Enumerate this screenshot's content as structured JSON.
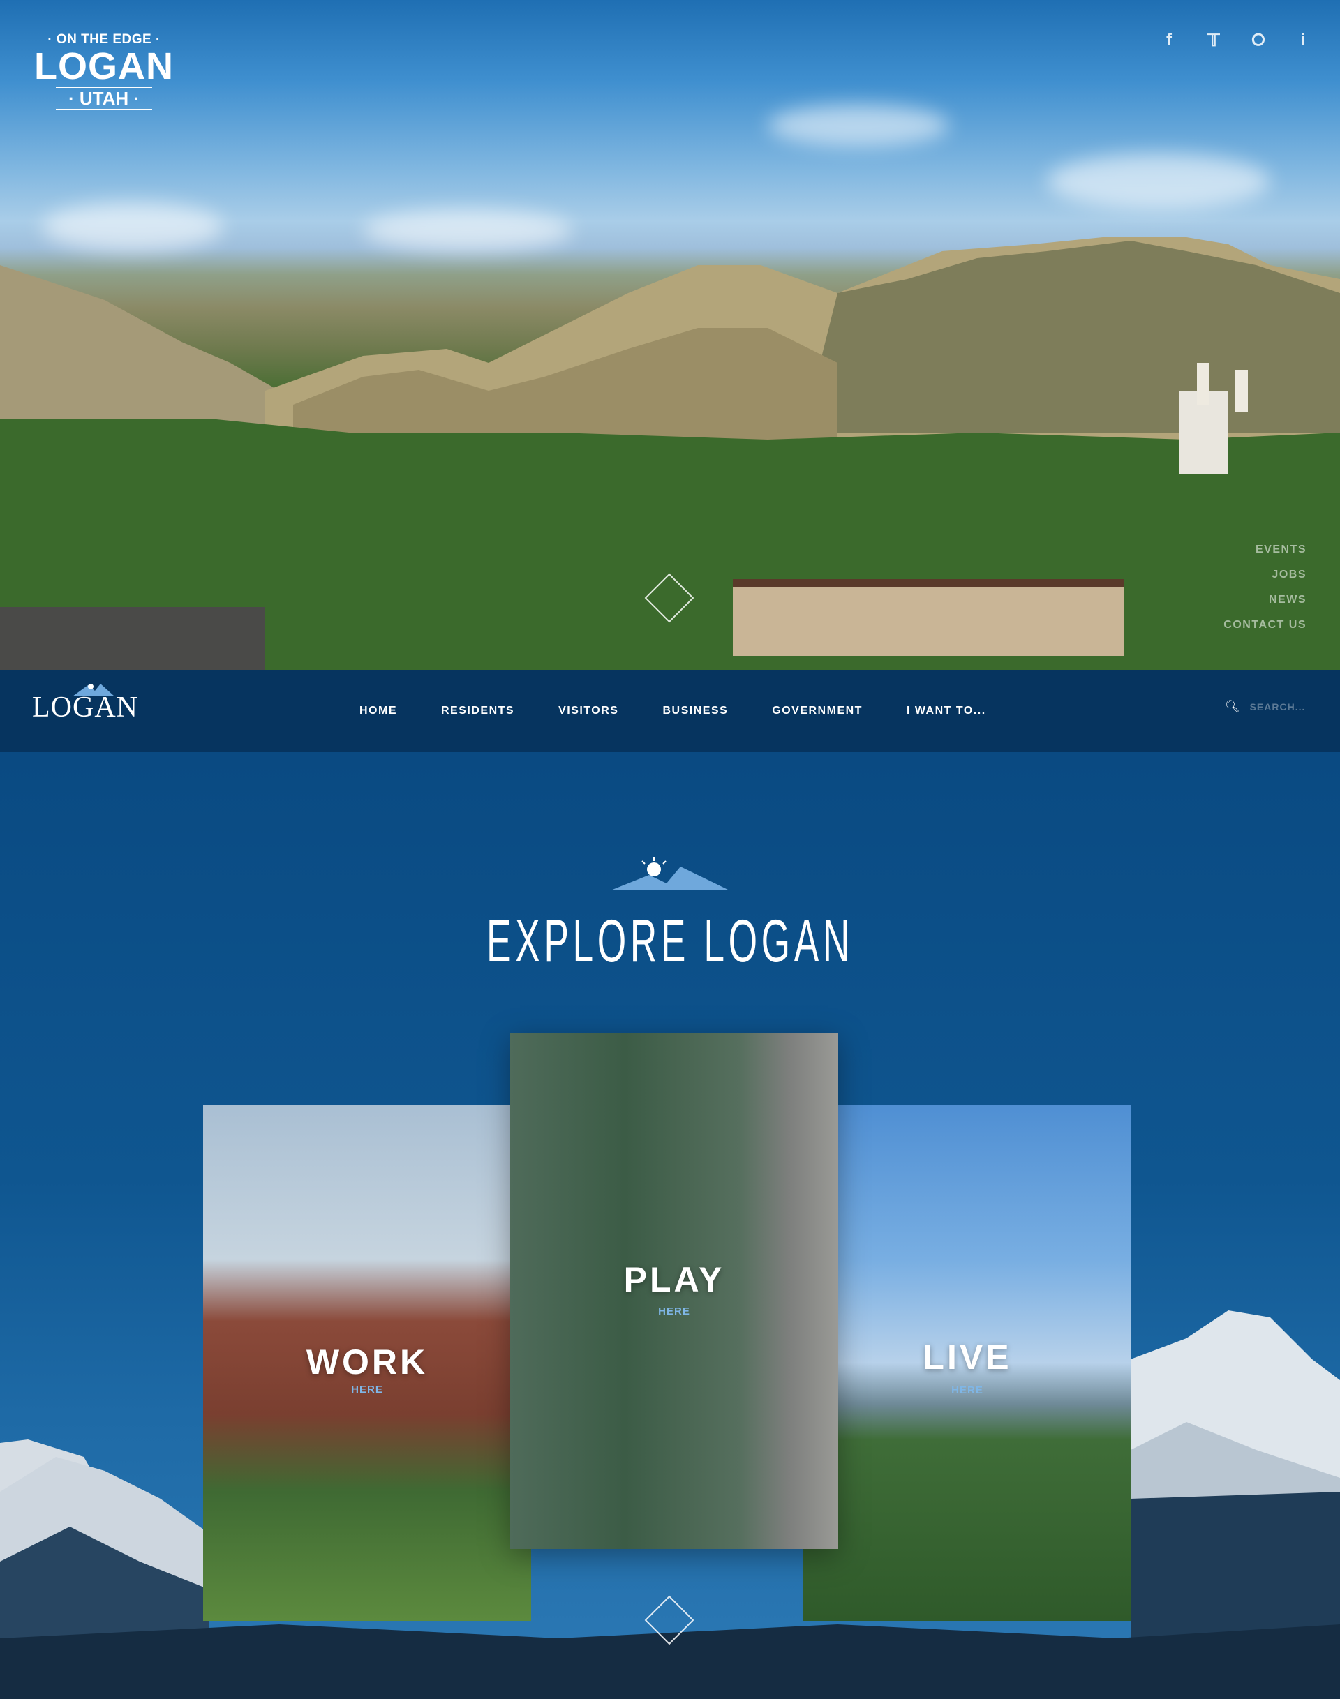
{
  "hero": {
    "logo": {
      "tagline": "· ON THE EDGE ·",
      "name": "LOGAN",
      "state": "· UTAH ·"
    },
    "social_icons": [
      "facebook-icon",
      "twitter-icon",
      "rss-icon",
      "info-icon"
    ],
    "side_links": [
      "EVENTS",
      "JOBS",
      "NEWS",
      "CONTACT US"
    ]
  },
  "nav": {
    "logo_text": "LOGAN",
    "menu": [
      "HOME",
      "RESIDENTS",
      "VISITORS",
      "BUSINESS",
      "GOVERNMENT",
      "I WANT TO..."
    ],
    "search_placeholder": "SEARCH..."
  },
  "explore": {
    "title": "EXPLORE LOGAN",
    "cards": [
      {
        "label": "WORK",
        "cta": "HERE"
      },
      {
        "label": "PLAY",
        "cta": "HERE"
      },
      {
        "label": "LIVE",
        "cta": "HERE"
      }
    ]
  },
  "colors": {
    "nav_bg": "#06345f",
    "section_bg": "#0b4a80",
    "accent": "#7fb6e6"
  }
}
